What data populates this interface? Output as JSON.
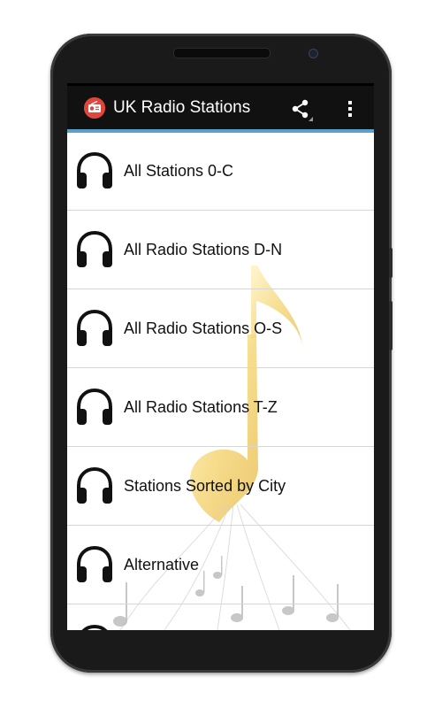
{
  "app": {
    "title": "UK Radio Stations",
    "icon": "radio-icon",
    "accent_color": "#5aa0c8",
    "bar_color": "#111111"
  },
  "toolbar": {
    "share_icon": "share-icon",
    "overflow_icon": "overflow-menu-icon"
  },
  "list": {
    "item_icon": "headphones-icon",
    "items": [
      {
        "label": "All Stations 0-C"
      },
      {
        "label": "All Radio Stations D-N"
      },
      {
        "label": "All Radio Stations O-S"
      },
      {
        "label": "All Radio Stations T-Z"
      },
      {
        "label": "Stations Sorted by City"
      },
      {
        "label": "Alternative"
      }
    ]
  }
}
